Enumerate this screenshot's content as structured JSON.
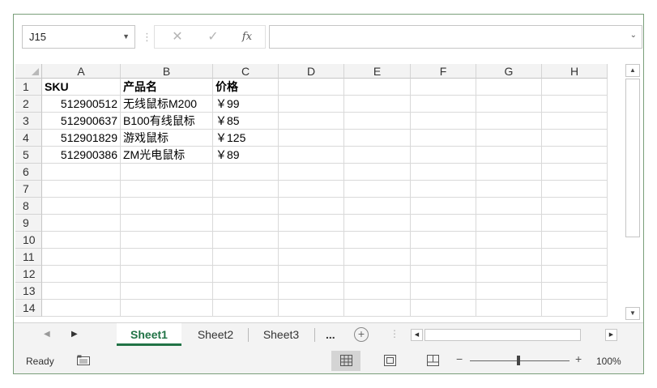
{
  "formula_bar": {
    "name_box": "J15",
    "cancel_glyph": "✕",
    "enter_glyph": "✓",
    "fx_label": "fx",
    "formula_value": ""
  },
  "columns": [
    "A",
    "B",
    "C",
    "D",
    "E",
    "F",
    "G",
    "H"
  ],
  "rows": [
    "1",
    "2",
    "3",
    "4",
    "5",
    "6",
    "7",
    "8",
    "9",
    "10",
    "11",
    "12",
    "13",
    "14"
  ],
  "table": {
    "headers": [
      "SKU",
      "产品名",
      "价格"
    ],
    "data": [
      [
        "512900512",
        "无线鼠标M200",
        "￥99"
      ],
      [
        "512900637",
        "B100有线鼠标",
        "￥85"
      ],
      [
        "512901829",
        "游戏鼠标",
        "￥125"
      ],
      [
        "512900386",
        "ZM光电鼠标",
        "￥89"
      ]
    ]
  },
  "sheet_tabs": {
    "tabs": [
      "Sheet1",
      "Sheet2",
      "Sheet3"
    ],
    "active": "Sheet1",
    "more": "...",
    "add": "+"
  },
  "status_bar": {
    "status": "Ready",
    "zoom_minus": "−",
    "zoom_plus": "+",
    "zoom": "100%"
  },
  "colors": {
    "accent": "#217346",
    "frame": "#7a9f7a",
    "header_bg": "#f3f3f3",
    "gridline": "#d9d9d9"
  },
  "icons": {
    "name_box_dropdown": "chevron-down-icon",
    "formula_expand": "chevron-down-icon",
    "cancel": "close-icon",
    "enter": "check-icon",
    "insert_function": "fx-icon",
    "new_sheet": "plus-circle-icon",
    "macro": "macro-record-icon",
    "normal_view": "grid-view-icon",
    "page_layout_view": "page-layout-icon",
    "page_break_view": "page-break-icon"
  }
}
